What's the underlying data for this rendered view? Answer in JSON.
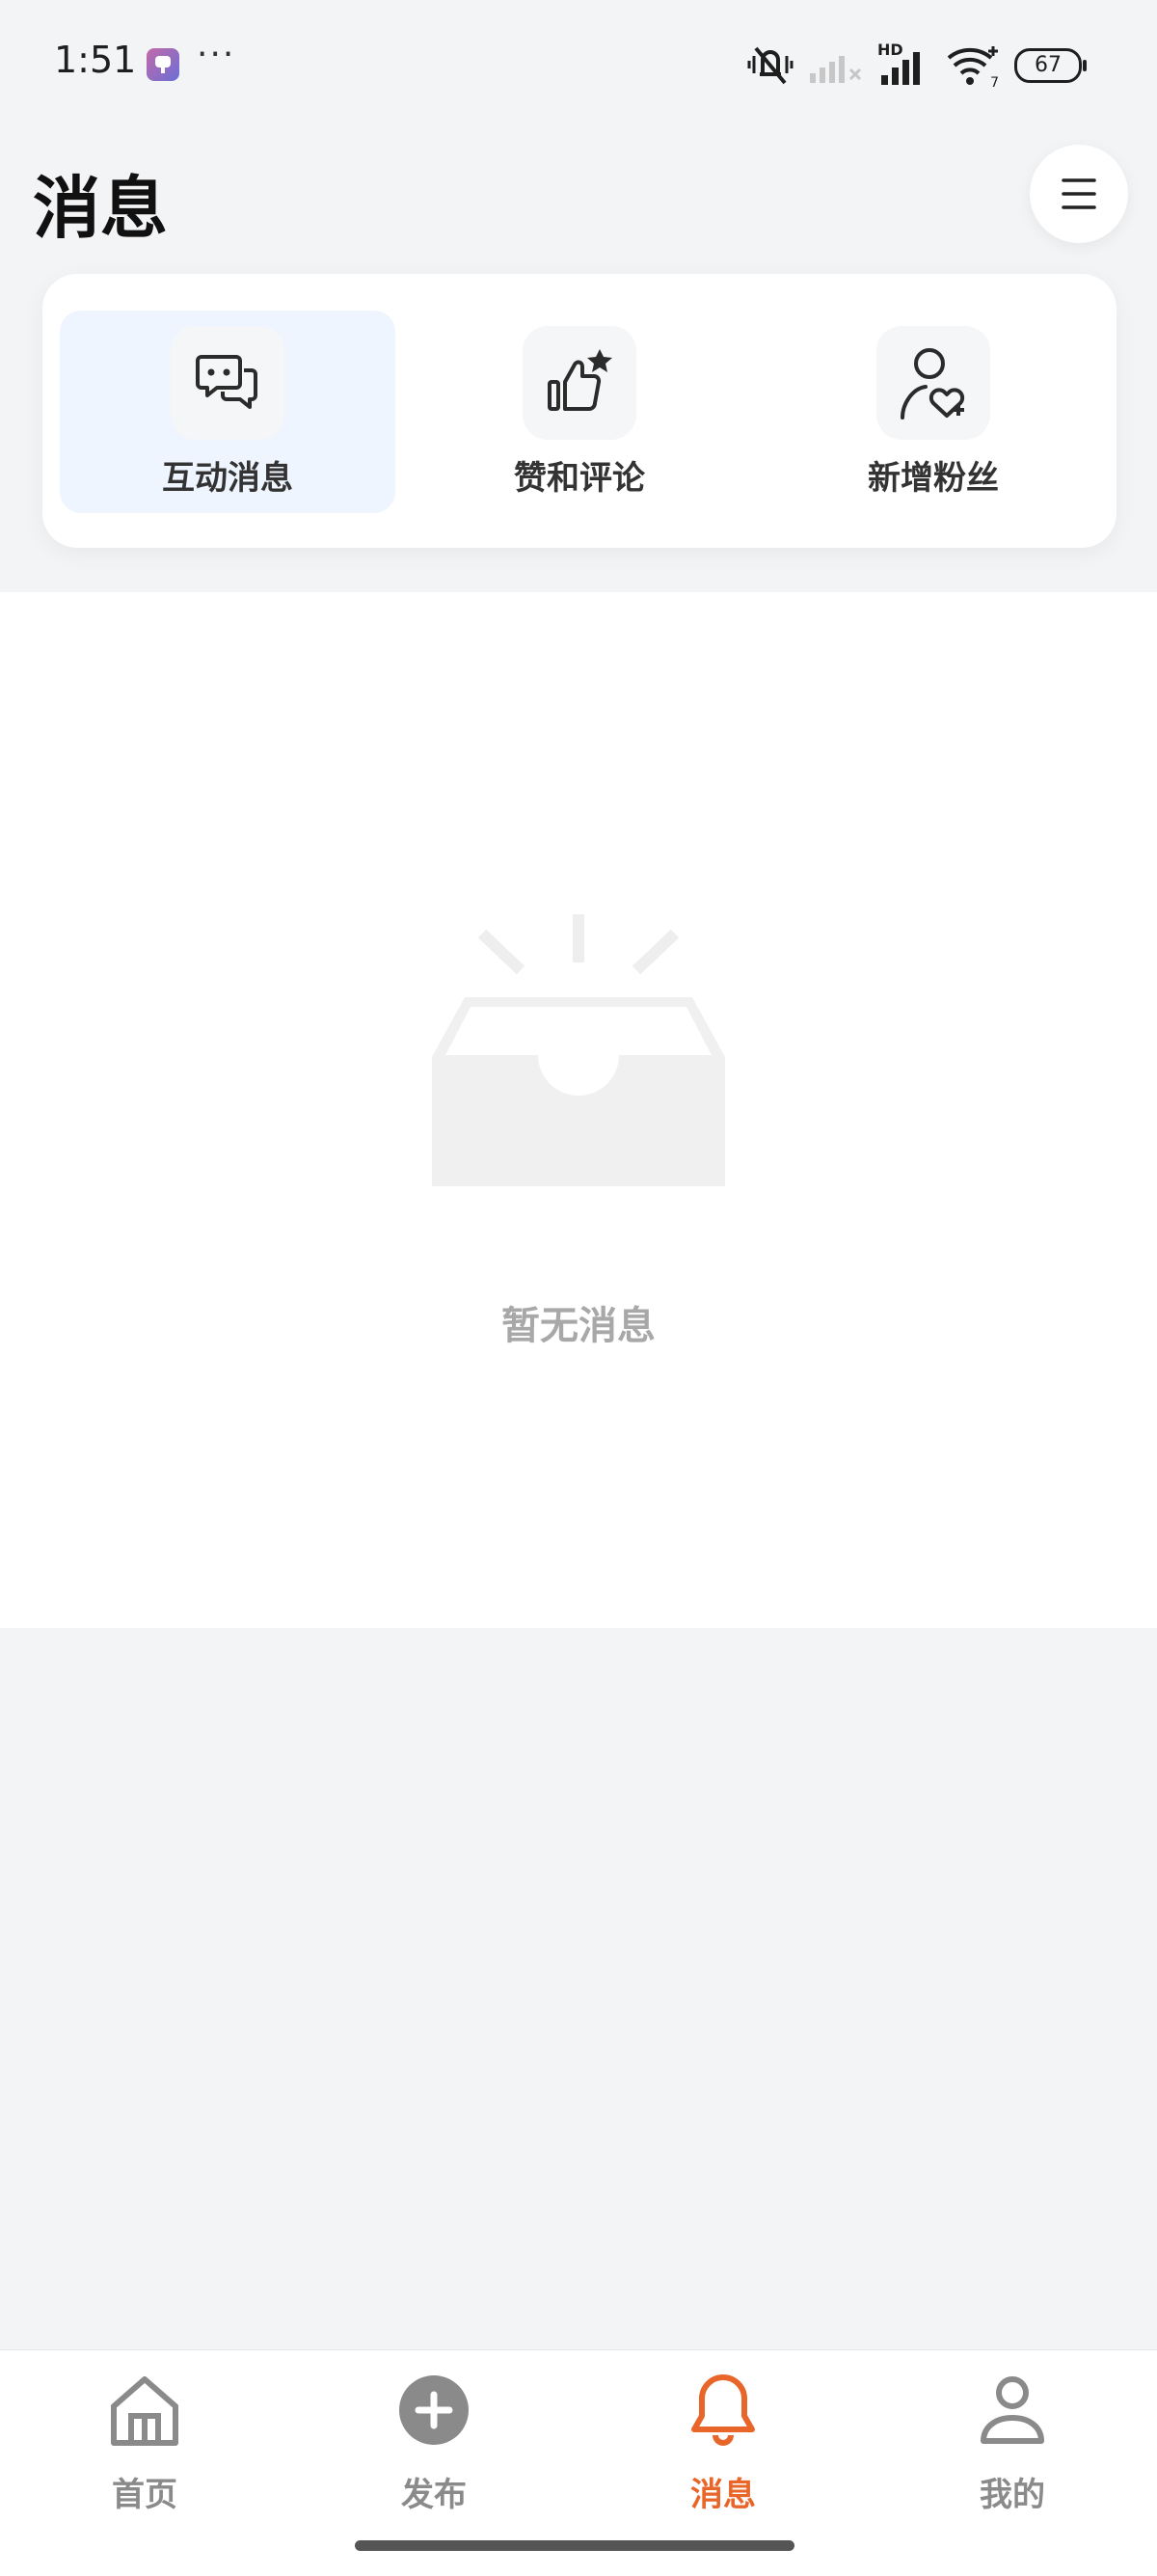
{
  "status_bar": {
    "time": "1:51",
    "more": "···",
    "wifi_badge": "7",
    "network_badge": "HD",
    "battery": "67"
  },
  "header": {
    "title": "消息",
    "menu_icon": "hamburger-menu-icon"
  },
  "tabs": [
    {
      "label": "互动消息",
      "icon": "chat-bubbles-icon",
      "active": true
    },
    {
      "label": "赞和评论",
      "icon": "thumbs-up-star-icon",
      "active": false
    },
    {
      "label": "新增粉丝",
      "icon": "person-heart-icon",
      "active": false
    }
  ],
  "empty_state": {
    "text": "暂无消息",
    "icon": "empty-inbox-icon"
  },
  "bottom_nav": [
    {
      "label": "首页",
      "icon": "home-icon",
      "active": false
    },
    {
      "label": "发布",
      "icon": "plus-circle-icon",
      "active": false
    },
    {
      "label": "消息",
      "icon": "bell-icon",
      "active": true
    },
    {
      "label": "我的",
      "icon": "user-icon",
      "active": false
    }
  ],
  "colors": {
    "accent": "#e8662a",
    "page_bg": "#f3f4f6",
    "active_tab_bg": "#eef5fe",
    "muted_text": "#a8a8a8"
  }
}
